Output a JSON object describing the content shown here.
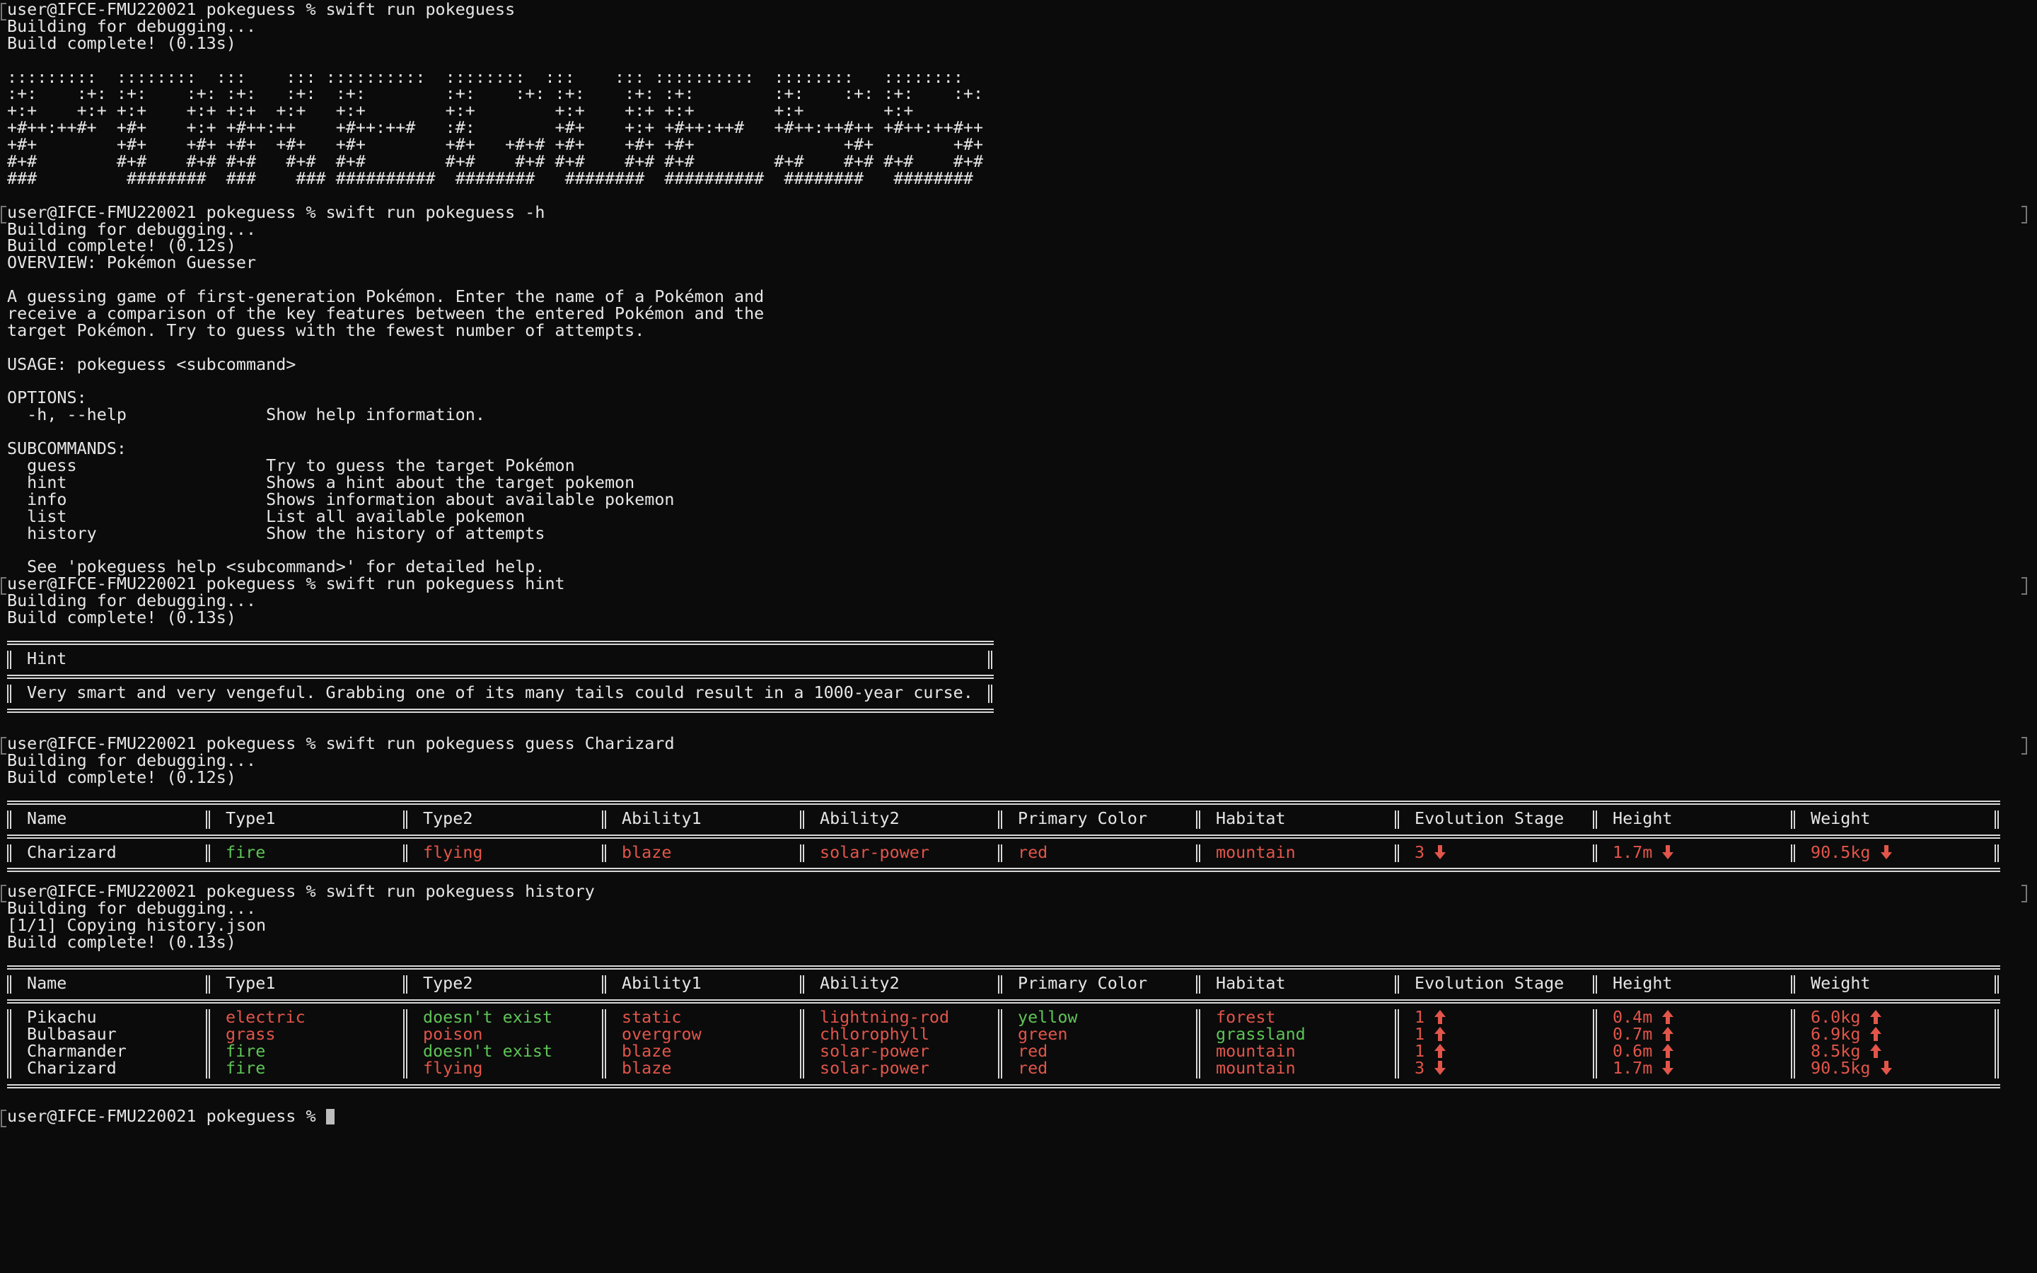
{
  "prompt": "user@IFCE-FMU220021 pokeguess %",
  "blocks": {
    "b1": {
      "command": "swift run pokeguess",
      "out": [
        "Building for debugging...",
        "Build complete! (0.13s)"
      ],
      "ascii": [
        ":::::::::  ::::::::  :::    ::: ::::::::::  ::::::::  :::    ::: ::::::::::  ::::::::   ::::::::",
        ":+:    :+: :+:    :+: :+:   :+:  :+:        :+:    :+: :+:    :+: :+:        :+:    :+: :+:    :+:",
        "+:+    +:+ +:+    +:+ +:+  +:+   +:+        +:+        +:+    +:+ +:+        +:+        +:+",
        "+#++:++#+  +#+    +:+ +#++:++    +#++:++#   :#:        +#+    +:+ +#++:++#   +#++:++#++ +#++:++#++",
        "+#+        +#+    +#+ +#+  +#+   +#+        +#+   +#+# +#+    +#+ +#+               +#+        +#+",
        "#+#        #+#    #+# #+#   #+#  #+#        #+#    #+# #+#    #+# #+#        #+#    #+# #+#    #+#",
        "###         ########  ###    ### ##########  ########   ########  ##########  ########   ########"
      ]
    },
    "b2": {
      "command": "swift run pokeguess -h",
      "out": [
        "Building for debugging...",
        "Build complete! (0.12s)",
        "OVERVIEW: Pokémon Guesser",
        "",
        "A guessing game of first-generation Pokémon. Enter the name of a Pokémon and",
        "receive a comparison of the key features between the entered Pokémon and the",
        "target Pokémon. Try to guess with the fewest number of attempts.",
        "",
        "USAGE: pokeguess <subcommand>",
        "",
        "OPTIONS:",
        "  -h, --help              Show help information.",
        "",
        "SUBCOMMANDS:",
        "  guess                   Try to guess the target Pokémon",
        "  hint                    Shows a hint about the target pokemon",
        "  info                    Shows information about available pokemon",
        "  list                    List all available pokemon",
        "  history                 Show the history of attempts",
        "",
        "  See 'pokeguess help <subcommand>' for detailed help."
      ]
    },
    "b3": {
      "command": "swift run pokeguess hint",
      "out": [
        "Building for debugging...",
        "Build complete! (0.13s)"
      ],
      "hint_title": "Hint",
      "hint_text": "Very smart and very vengeful. Grabbing one of its many tails could result in a 1000-year curse."
    },
    "b4": {
      "command": "swift run pokeguess guess Charizard",
      "out": [
        "Building for debugging...",
        "Build complete! (0.12s)"
      ]
    },
    "b5": {
      "command": "swift run pokeguess history",
      "out": [
        "Building for debugging...",
        "[1/1] Copying history.json",
        "Build complete! (0.13s)"
      ]
    }
  },
  "table": {
    "headers": [
      "Name",
      "Type1",
      "Type2",
      "Ability1",
      "Ability2",
      "Primary Color",
      "Habitat",
      "Evolution Stage",
      "Height",
      "Weight"
    ]
  },
  "guess_rows": [
    {
      "name": "Charizard",
      "cells": [
        {
          "t": "fire",
          "c": "green"
        },
        {
          "t": "flying",
          "c": "red"
        },
        {
          "t": "blaze",
          "c": "red"
        },
        {
          "t": "solar-power",
          "c": "red"
        },
        {
          "t": "red",
          "c": "red"
        },
        {
          "t": "mountain",
          "c": "red"
        },
        {
          "t": "3",
          "c": "red",
          "a": "down"
        },
        {
          "t": "1.7m",
          "c": "red",
          "a": "down"
        },
        {
          "t": "90.5kg",
          "c": "red",
          "a": "down"
        }
      ]
    }
  ],
  "history_rows": [
    {
      "name": "Pikachu",
      "cells": [
        {
          "t": "electric",
          "c": "red"
        },
        {
          "t": "doesn't exist",
          "c": "green"
        },
        {
          "t": "static",
          "c": "red"
        },
        {
          "t": "lightning-rod",
          "c": "red"
        },
        {
          "t": "yellow",
          "c": "green"
        },
        {
          "t": "forest",
          "c": "red"
        },
        {
          "t": "1",
          "c": "red",
          "a": "up"
        },
        {
          "t": "0.4m",
          "c": "red",
          "a": "up"
        },
        {
          "t": "6.0kg",
          "c": "red",
          "a": "up"
        }
      ]
    },
    {
      "name": "Bulbasaur",
      "cells": [
        {
          "t": "grass",
          "c": "red"
        },
        {
          "t": "poison",
          "c": "red"
        },
        {
          "t": "overgrow",
          "c": "red"
        },
        {
          "t": "chlorophyll",
          "c": "red"
        },
        {
          "t": "green",
          "c": "red"
        },
        {
          "t": "grassland",
          "c": "green"
        },
        {
          "t": "1",
          "c": "red",
          "a": "up"
        },
        {
          "t": "0.7m",
          "c": "red",
          "a": "up"
        },
        {
          "t": "6.9kg",
          "c": "red",
          "a": "up"
        }
      ]
    },
    {
      "name": "Charmander",
      "cells": [
        {
          "t": "fire",
          "c": "green"
        },
        {
          "t": "doesn't exist",
          "c": "green"
        },
        {
          "t": "blaze",
          "c": "red"
        },
        {
          "t": "solar-power",
          "c": "red"
        },
        {
          "t": "red",
          "c": "red"
        },
        {
          "t": "mountain",
          "c": "red"
        },
        {
          "t": "1",
          "c": "red",
          "a": "up"
        },
        {
          "t": "0.6m",
          "c": "red",
          "a": "up"
        },
        {
          "t": "8.5kg",
          "c": "red",
          "a": "up"
        }
      ]
    },
    {
      "name": "Charizard",
      "cells": [
        {
          "t": "fire",
          "c": "green"
        },
        {
          "t": "flying",
          "c": "red"
        },
        {
          "t": "blaze",
          "c": "red"
        },
        {
          "t": "solar-power",
          "c": "red"
        },
        {
          "t": "red",
          "c": "red"
        },
        {
          "t": "mountain",
          "c": "red"
        },
        {
          "t": "3",
          "c": "red",
          "a": "down"
        },
        {
          "t": "1.7m",
          "c": "red",
          "a": "down"
        },
        {
          "t": "90.5kg",
          "c": "red",
          "a": "down"
        }
      ]
    }
  ],
  "colors": {
    "green": "#5ec457",
    "red": "#e2554a",
    "text": "#e6e6e6",
    "background": "#0b0b0b"
  },
  "icons": {
    "up": "arrow-up-icon",
    "down": "arrow-down-icon"
  }
}
